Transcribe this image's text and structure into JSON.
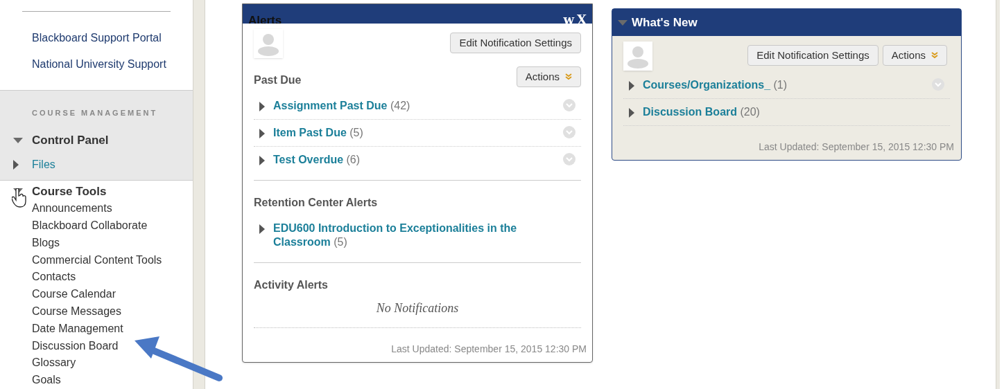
{
  "sidebar": {
    "links": [
      "Blackboard Support Portal",
      "National University Support"
    ],
    "section_title": "COURSE MANAGEMENT",
    "menu": [
      {
        "label": "Control Panel",
        "kind": "header",
        "expanded": true
      },
      {
        "label": "Files",
        "kind": "link",
        "expanded": false
      }
    ],
    "tools": {
      "label": "Course Tools",
      "expanded": true,
      "children": [
        "Announcements",
        "Blackboard Collaborate",
        "Blogs",
        "Commercial Content Tools",
        "Contacts",
        "Course Calendar",
        "Course Messages",
        "Date Management",
        "Discussion Board",
        "Glossary",
        "Goals"
      ]
    }
  },
  "alerts": {
    "title": "Alerts",
    "header_controls": [
      "w",
      "X"
    ],
    "buttons": [
      "Edit Notification Settings",
      "Actions"
    ],
    "sections": [
      {
        "title": "Past Due",
        "items": [
          {
            "label": "Assignment Past Due",
            "count": "(42)",
            "expanded": false,
            "has_menu": true
          },
          {
            "label": "Item Past Due",
            "count": "(5)",
            "expanded": false,
            "has_menu": true
          },
          {
            "label": "Test Overdue",
            "count": "(6)",
            "expanded": false,
            "has_menu": true
          }
        ]
      },
      {
        "title": "Retention Center Alerts",
        "items": [
          {
            "label": "EDU600 Introduction to Exceptionalities in the Classroom",
            "count": "(5)",
            "expanded": false,
            "has_menu": false
          }
        ]
      },
      {
        "title": "Activity Alerts",
        "empty_message": "No Notifications"
      }
    ],
    "last_updated": "Last Updated: September 15, 2015 12:30 PM"
  },
  "whats_new": {
    "title": "What's New",
    "expanded": true,
    "buttons": [
      "Edit Notification Settings",
      "Actions"
    ],
    "items": [
      {
        "label": "Courses/Organizations_",
        "count": "(1)",
        "expanded": false,
        "has_menu": true
      },
      {
        "label": "Discussion Board",
        "count": "(20)",
        "expanded": false,
        "has_menu": false
      }
    ],
    "last_updated": "Last Updated: September 15, 2015 12:30 PM"
  }
}
